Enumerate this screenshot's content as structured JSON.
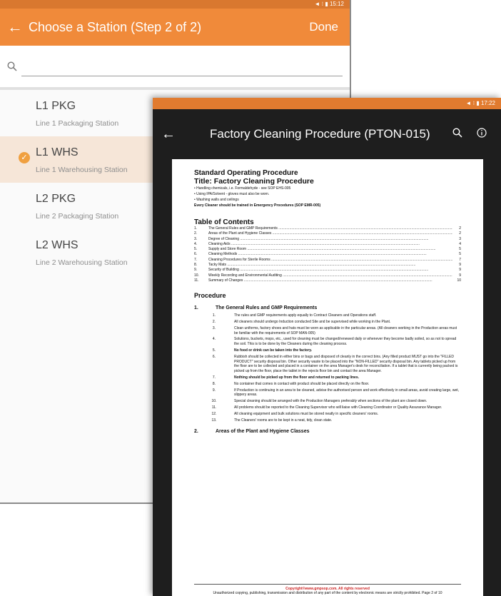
{
  "back_phone": {
    "status": "◄ ⁝ ▮ 15:12",
    "toolbar": {
      "back": "←",
      "title": "Choose a Station (Step 2 of 2)",
      "done": "Done"
    },
    "search": {
      "icon": "search-icon",
      "placeholder": ""
    },
    "stations": [
      {
        "code": "L1 PKG",
        "desc": "Line 1 Packaging Station",
        "selected": false
      },
      {
        "code": "L1 WHS",
        "desc": "Line 1 Warehousing Station",
        "selected": true
      },
      {
        "code": "L2 PKG",
        "desc": "Line 2 Packaging Station",
        "selected": false
      },
      {
        "code": "L2 WHS",
        "desc": "Line 2 Warehousing Station",
        "selected": false
      }
    ],
    "colors": {
      "toolbar": "#f08a3a",
      "selected_row": "#f6e6d8",
      "check": "#f0a040"
    }
  },
  "front_phone": {
    "status": "◄ ⁝ ▮ 17:22",
    "toolbar": {
      "back": "←",
      "title": "Factory Cleaning Procedure (PTON-015)",
      "search_icon": "search-icon",
      "info_icon": "info-icon"
    },
    "document": {
      "heading": "Standard Operating Procedure",
      "title": "Title: Factory Cleaning Procedure",
      "bullets": [
        "•  Handling chemicals, i.e. Formaldehyde - see SOP EHS-005",
        "•  Using IPA/Solvent - gloves must also be worn.",
        "•  Washing walls and ceilings"
      ],
      "training_note": "Every Cleaner should be trained in Emergency Procedures (SOP EMR-005)",
      "toc_heading": "Table of Contents",
      "toc": [
        {
          "n": "1.",
          "t": "The General Rules and GMP Requirements",
          "p": "2"
        },
        {
          "n": "2.",
          "t": "Areas of the Plant and Hygiene Classes",
          "p": "2"
        },
        {
          "n": "3.",
          "t": "Degree of Cleaning",
          "p": "3"
        },
        {
          "n": "4.",
          "t": "Cleaning Aids",
          "p": "4"
        },
        {
          "n": "5.",
          "t": "Supply and Store Room",
          "p": "5"
        },
        {
          "n": "6.",
          "t": "Cleaning Methods",
          "p": "5"
        },
        {
          "n": "7.",
          "t": "Cleaning Procedures for Sterile Rooms",
          "p": "7"
        },
        {
          "n": "8.",
          "t": "Tacky Mats",
          "p": "9"
        },
        {
          "n": "9.",
          "t": "Security of Building",
          "p": "9"
        },
        {
          "n": "10.",
          "t": "Weekly Recording and Environmental Auditing",
          "p": "9"
        },
        {
          "n": "11.",
          "t": "Summary of Changes",
          "p": "10"
        }
      ],
      "procedure_heading": "Procedure",
      "section1": {
        "n": "1.",
        "title": "The General Rules and GMP Requirements"
      },
      "items": [
        {
          "n": "1.",
          "t": "The rules and GMP requirements apply equally to Contract Cleaners and Operations staff.",
          "bold": false
        },
        {
          "n": "2.",
          "t": "All cleaners should undergo Induction conducted Site and be supervised while working in the Plant.",
          "bold": false
        },
        {
          "n": "3.",
          "t": "Clean uniforms, factory shoes and hats must be worn as applicable in the particular areas. (All cleaners working in the Production areas must be familiar with the requirements of SOP MAN-005)",
          "bold": false
        },
        {
          "n": "4.",
          "t": "Solutions, buckets, mops, etc., used for cleaning must be changed/renewed daily or whenever they become badly soiled, so as not to spread the soil. This is to be done by the Cleaners during the cleaning process.",
          "bold": false
        },
        {
          "n": "5.",
          "t": "No food or drink can be taken into the factory.",
          "bold": true
        },
        {
          "n": "6.",
          "t": "Rubbish should be collected in either bins or bags and disposed of cleanly in the correct bins. (Any filled product MUST go into the \"FILLED PRODUCT\" security disposal bin. Other security waste to be placed into the \"NON-FILLED\" security disposal bin. Any tablets picked up from the floor are to be collected and placed in a container on the area Manager's desk for reconciliation. If a tablet that is currently being packed is picked up from the floor, place the tablet in the rejects floor bin and contact the area Manager.",
          "bold": false
        },
        {
          "n": "7.",
          "t": "Nothing should be picked up from the floor and returned to packing lines.",
          "bold": true
        },
        {
          "n": "8.",
          "t": "No container that comes in contact with product should be placed directly on the floor.",
          "bold": false
        },
        {
          "n": "9.",
          "t": "If Production is continuing in an area to be cleaned, advise the authorised person and work effectively in small areas, avoid creating large, wet, slippery areas.",
          "bold": false
        },
        {
          "n": "10.",
          "t": "Special cleaning should be arranged with the Production Managers preferably when sections of the plant are closed down.",
          "bold": false
        },
        {
          "n": "11.",
          "t": "All problems should be reported to the Cleaning Supervisor who will liaise with Cleaning Coordinator or Quality Assurance Manager.",
          "bold": false
        },
        {
          "n": "12.",
          "t": "All cleaning equipment and bulk solutions must be stored neatly in specific cleaners' rooms.",
          "bold": false
        },
        {
          "n": "13.",
          "t": "The Cleaners' rooms are to be kept in a neat, tidy, clean state.",
          "bold": false
        }
      ],
      "section2": {
        "n": "2.",
        "title": "Areas of the Plant and Hygiene Classes"
      },
      "footer": {
        "copyright": "Copyright©www.gmpsop.com. All rights reserved",
        "notice": "Unauthorized copying, publishing, transmission and distribution of any part of the content by electronic means are strictly prohibited. Page 2 of 10"
      }
    }
  }
}
